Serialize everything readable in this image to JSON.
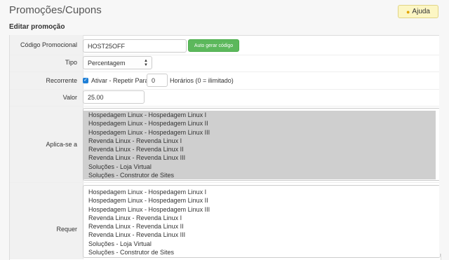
{
  "header": {
    "title": "Promoções/Cupons",
    "help_label": "Ajuda",
    "section_title": "Editar promoção"
  },
  "form": {
    "code": {
      "label": "Código Promocional",
      "value": "HOST25OFF",
      "auto_label": "Auto gerar código"
    },
    "type": {
      "label": "Tipo",
      "value": "Percentagem"
    },
    "recurring": {
      "label": "Recorrente",
      "checked": true,
      "checkbox_label": "Ativar - Repetir Para",
      "value": "0",
      "suffix": "Horários (0 = ilimitado)"
    },
    "value": {
      "label": "Valor",
      "value": "25.00"
    },
    "applies_to": {
      "label": "Aplica-se a",
      "options": [
        "Hospedagem Linux - Hospedagem Linux I",
        "Hospedagem Linux - Hospedagem Linux II",
        "Hospedagem Linux - Hospedagem Linux III",
        "Revenda Linux - Revenda Linux I",
        "Revenda Linux - Revenda Linux II",
        "Revenda Linux - Revenda Linux III",
        "Soluções - Loja Virtual",
        "Soluções - Construtor de Sites"
      ]
    },
    "requires": {
      "label": "Requer",
      "options": [
        "Hospedagem Linux - Hospedagem Linux I",
        "Hospedagem Linux - Hospedagem Linux II",
        "Hospedagem Linux - Hospedagem Linux III",
        "Revenda Linux - Revenda Linux I",
        "Revenda Linux - Revenda Linux II",
        "Revenda Linux - Revenda Linux III",
        "Soluções - Loja Virtual",
        "Soluções - Construtor de Sites"
      ]
    }
  },
  "colors": {
    "accent_green": "#5cb85c",
    "help_bg": "#fcf6c4",
    "checkbox_blue": "#1e7fd6"
  },
  "icons": {
    "help": "lightbulb-icon",
    "select": "chevron-updown-icon",
    "checkbox": "check-icon"
  }
}
